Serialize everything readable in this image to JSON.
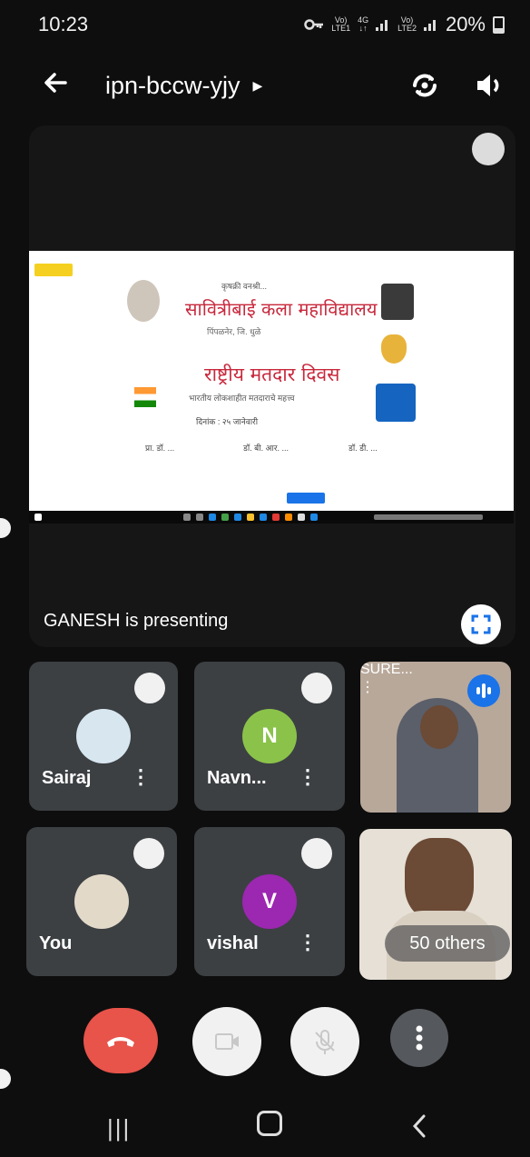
{
  "status_bar": {
    "time": "10:23",
    "sim1_top": "Vo)",
    "sim1_bottom": "LTE1",
    "net_top": "4G",
    "net_bottom": "↓↑",
    "sim2_top": "Vo)",
    "sim2_bottom": "LTE2",
    "battery": "20%"
  },
  "top_bar": {
    "meeting_code": "ipn-bccw-yjy",
    "back_icon": "arrow-left-icon",
    "switch_camera_icon": "switch-camera-icon",
    "audio_icon": "speaker-icon"
  },
  "presentation": {
    "slide": {
      "college_top": "कृषक्री वनश्री...",
      "college_name": "सावित्रीबाई कला महाविद्यालय",
      "college_sub": "पिंपळनेर, जि. धुळे",
      "event_title": "राष्ट्रीय मतदार दिवस",
      "event_sub": "भारतीय लोकशाहीत मतदाराचे महत्त्व",
      "date_line": "दिनांक : २५ जानेवारी",
      "names": [
        "प्रा. डॉ. ...",
        "डॉ. बी. आर. ...",
        "डॉ. डी. ..."
      ]
    },
    "presenting_text": "GANESH is presenting",
    "fullscreen_icon": "fullscreen-icon"
  },
  "participants": [
    {
      "name": "Sairaj",
      "type": "photo-avatar"
    },
    {
      "name": "Navn...",
      "initial": "N",
      "color": "#8bc34a"
    },
    {
      "name": "SURE...",
      "type": "video"
    },
    {
      "name": "You",
      "type": "photo-avatar"
    },
    {
      "name": "vishal",
      "initial": "V",
      "color": "#9c27b0"
    },
    {
      "others_label": "50 others",
      "type": "video"
    }
  ],
  "controls": {
    "end_call_icon": "phone-hangup-icon",
    "camera_icon": "camera-off-icon",
    "mic_icon": "mic-off-icon",
    "more_icon": "more-vertical-icon"
  },
  "nav": {
    "recent": "|||"
  }
}
